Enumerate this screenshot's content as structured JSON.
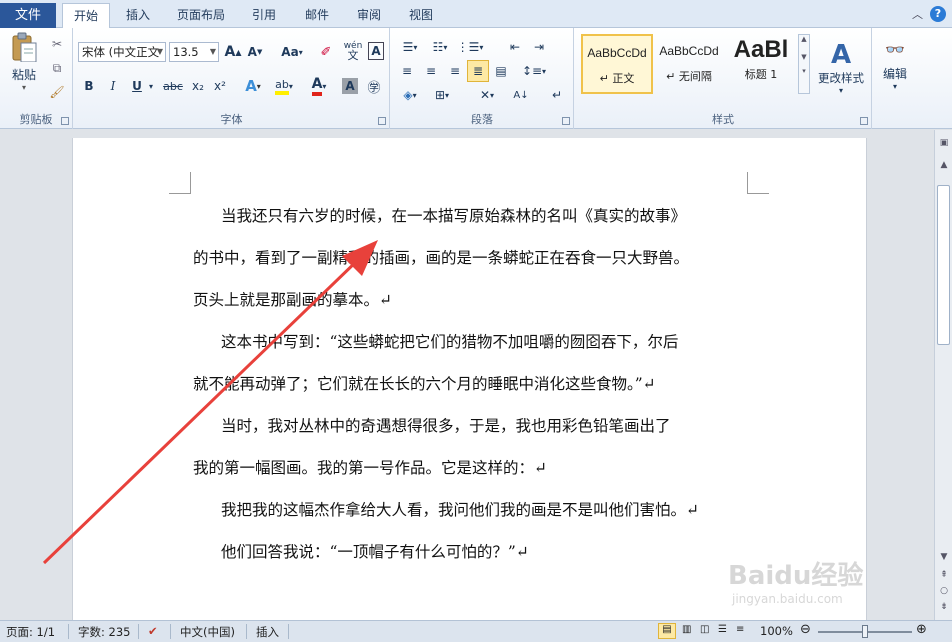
{
  "tabs": {
    "file": "文件",
    "items": [
      "开始",
      "插入",
      "页面布局",
      "引用",
      "邮件",
      "审阅",
      "视图"
    ],
    "help": "?"
  },
  "ribbon": {
    "clipboard": {
      "label": "剪贴板",
      "paste": "粘贴"
    },
    "font": {
      "label": "字体",
      "font_name": "宋体 (中文正文",
      "font_size": "13.5",
      "grow": "A",
      "shrink": "A",
      "change_case": "Aa",
      "bold": "B",
      "italic": "I",
      "underline": "U",
      "strikethrough": "abc",
      "subscript": "x₂",
      "superscript": "x²",
      "wen": "wén"
    },
    "paragraph": {
      "label": "段落"
    },
    "styles": {
      "label": "样式",
      "items": [
        {
          "sample": "AaBbCcDd",
          "name": "↵ 正文"
        },
        {
          "sample": "AaBbCcDd",
          "name": "↵ 无间隔"
        },
        {
          "sample": "AaBl",
          "name": "标题 1"
        }
      ],
      "change_styles": "更改样式"
    },
    "editing": {
      "label": "编辑"
    }
  },
  "document": {
    "lines": [
      "当我还只有六岁的时候，在一本描写原始森林的名叫《真实的故事》",
      "的书中，看到了一副精彩的插画，画的是一条蟒蛇正在吞食一只大野兽。",
      "页头上就是那副画的摹本。↵",
      "这本书中写到：“这些蟒蛇把它们的猎物不加咀嚼的囫囵吞下，尔后",
      "就不能再动弹了；它们就在长长的六个月的睡眠中消化这些食物。”↵",
      "当时，我对丛林中的奇遇想得很多，于是，我也用彩色铅笔画出了",
      "我的第一幅图画。我的第一号作品。它是这样的：↵",
      "我把我的这幅杰作拿给大人看，我问他们我的画是不是叫他们害怕。↵",
      "他们回答我说：“一顶帽子有什么可怕的？”↵"
    ]
  },
  "status": {
    "page": "页面: 1/1",
    "words": "字数: 235",
    "language": "中文(中国)",
    "mode": "插入",
    "zoom": "100%"
  },
  "watermark": {
    "brand": "Baidu经验",
    "url": "jingyan.baidu.com"
  },
  "colors": {
    "file_tab": "#2b579a",
    "arrow": "#e8413b",
    "link_text": "#2c4f9a"
  }
}
